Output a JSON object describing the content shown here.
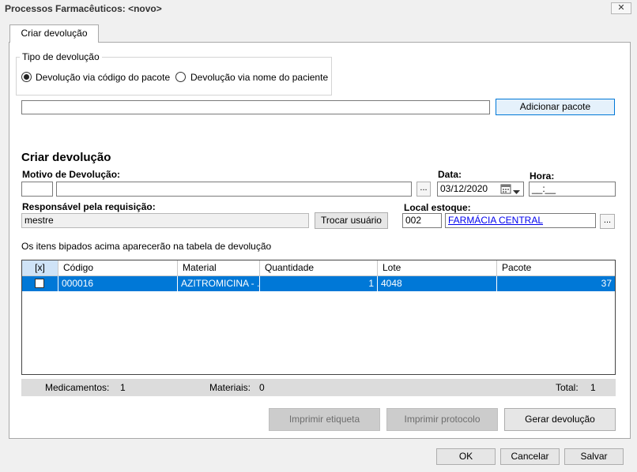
{
  "window": {
    "title": "Processos Farmacêuticos: <novo>",
    "close_label": "✕"
  },
  "tab": {
    "label": "Criar devolução"
  },
  "tipo": {
    "legend": "Tipo de devolução",
    "option_codigo": "Devolução via código do pacote",
    "option_nome": "Devolução via nome do paciente",
    "selected": "codigo"
  },
  "pacote": {
    "input_value": "",
    "add_button": "Adicionar pacote"
  },
  "form": {
    "section_title": "Criar devolução",
    "motivo_label": "Motivo de Devolução:",
    "motivo_code": "",
    "motivo_text": "",
    "ellipsis": "...",
    "data_label": "Data:",
    "data_value": "03/12/2020",
    "hora_label": "Hora:",
    "hora_value": "__:__",
    "responsavel_label": "Responsável pela requisição:",
    "responsavel_value": "mestre",
    "trocar_button": "Trocar usuário",
    "local_label": "Local estoque:",
    "local_code": "002",
    "local_name": "FARMÁCIA CENTRAL"
  },
  "info_text": "Os itens bipados acima aparecerão na tabela de devolução",
  "grid": {
    "columns": [
      "[x]",
      "Código",
      "Material",
      "Quantidade",
      "Lote",
      "Pacote"
    ],
    "rows": [
      {
        "checked": false,
        "codigo": "000016",
        "material": "AZITROMICINA - ...",
        "quantidade": "1",
        "lote": "4048",
        "pacote": "37"
      }
    ]
  },
  "summary": {
    "medicamentos_label": "Medicamentos:",
    "medicamentos_value": "1",
    "materiais_label": "Materiais:",
    "materiais_value": "0",
    "total_label": "Total:",
    "total_value": "1"
  },
  "actions": {
    "imprimir_etiqueta": "Imprimir etiqueta",
    "imprimir_protocolo": "Imprimir protocolo",
    "gerar_devolucao": "Gerar devolução"
  },
  "footer": {
    "ok": "OK",
    "cancelar": "Cancelar",
    "salvar": "Salvar"
  },
  "colors": {
    "selection": "#0078d7",
    "focus_border": "#0078d7",
    "link": "#0000ee"
  },
  "icons": {
    "calendar": "calendar-icon",
    "dropdown": "chevron-down-icon",
    "close": "close-icon"
  }
}
